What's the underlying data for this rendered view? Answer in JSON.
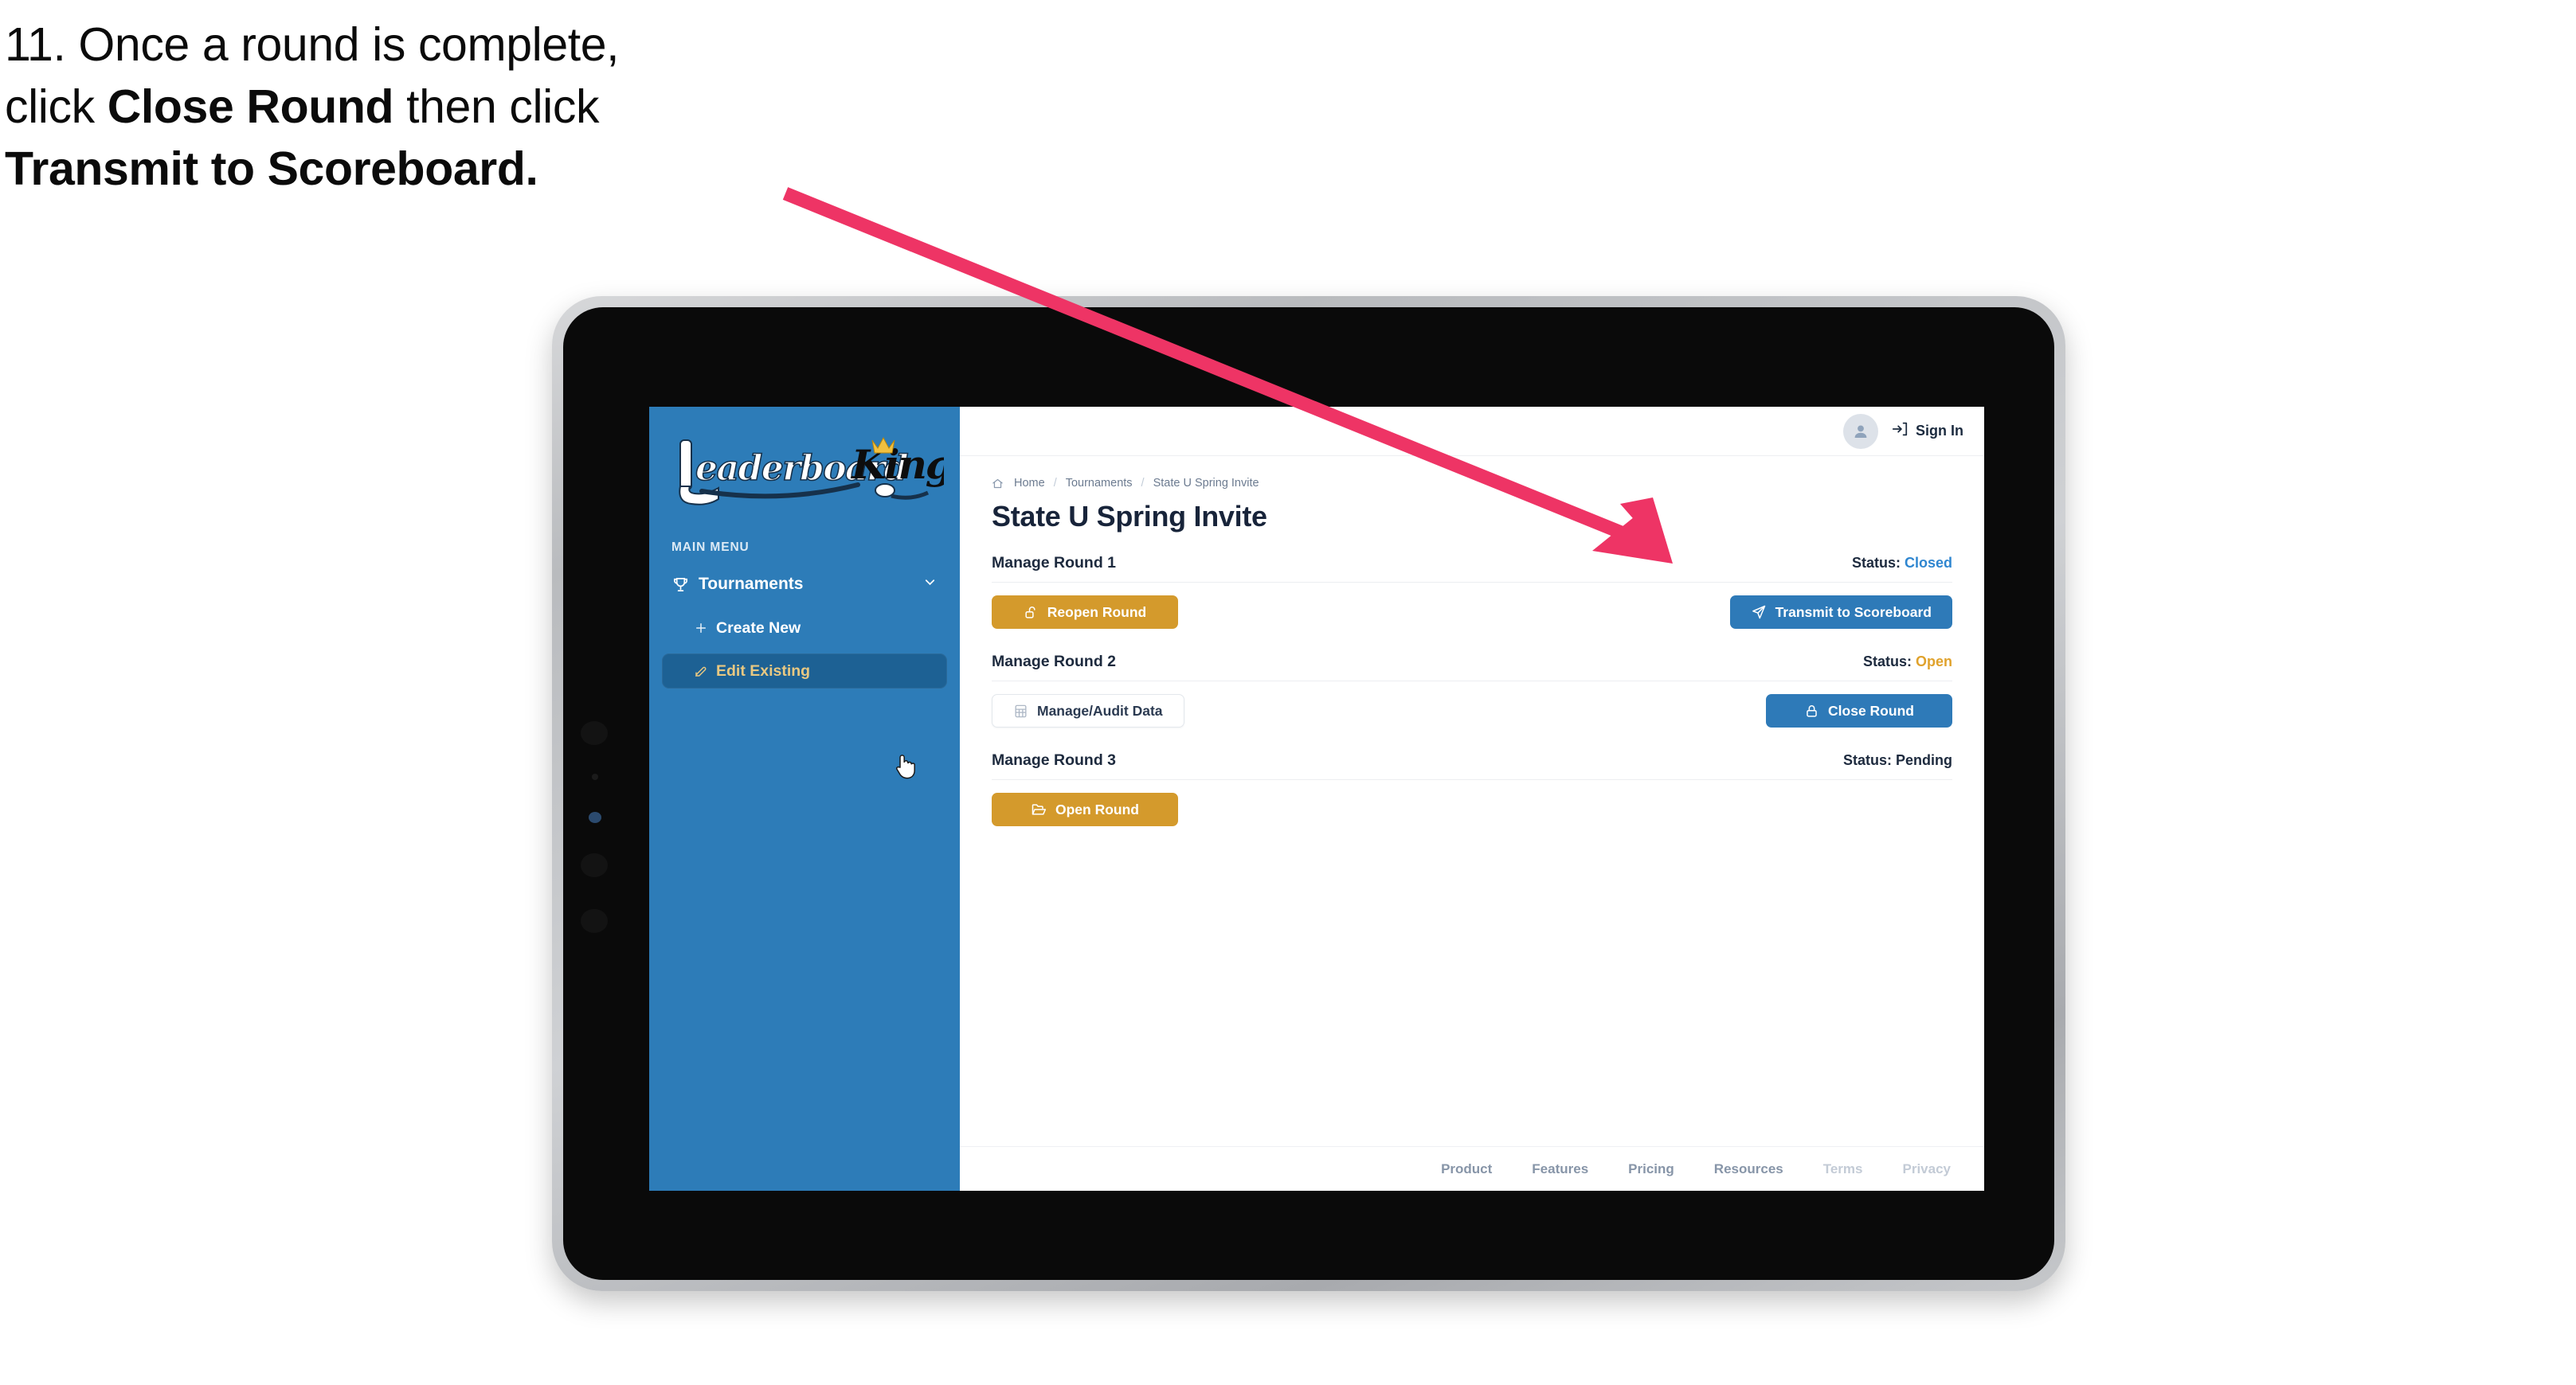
{
  "instruction": {
    "step_number": "11.",
    "line1_prefix": "11. Once a round is complete,",
    "line2_prefix": "click ",
    "line2_bold": "Close Round",
    "line2_suffix": " then click",
    "line3_bold": "Transmit to Scoreboard.",
    "arrow_color": "#ee3465"
  },
  "app": {
    "sidebar": {
      "logo": {
        "word_one": "Leaderboard",
        "word_two": "King",
        "crown_color": "#f0c040"
      },
      "section_label": "MAIN MENU",
      "items": [
        {
          "label": "Tournaments",
          "icon": "trophy-icon",
          "chevron": "chevron-down-icon",
          "active": false
        },
        {
          "label": "Create New",
          "icon": "plus-icon",
          "active": false
        },
        {
          "label": "Edit Existing",
          "icon": "edit-pencil-icon",
          "active": true
        }
      ],
      "background_color": "#2d7cb8",
      "active_background_color": "#1d6194",
      "active_text_color": "#e8c882"
    },
    "topbar": {
      "avatar_icon": "user-avatar-icon",
      "signin_icon": "sign-in-arrow-icon",
      "signin_label": "Sign In"
    },
    "breadcrumb": {
      "home_icon": "home-icon",
      "items": [
        "Home",
        "Tournaments",
        "State U Spring Invite"
      ],
      "separator": "/"
    },
    "page_title": "State U Spring Invite",
    "rounds": [
      {
        "name": "Manage Round 1",
        "status_label": "Status:",
        "status_value": "Closed",
        "status_class": "status-closed",
        "left_button": {
          "label": "Reopen Round",
          "icon": "unlock-icon",
          "style": "btn-gold"
        },
        "right_button": {
          "label": "Transmit to Scoreboard",
          "icon": "send-paper-plane-icon",
          "style": "btn-blue"
        }
      },
      {
        "name": "Manage Round 2",
        "status_label": "Status:",
        "status_value": "Open",
        "status_class": "status-open",
        "left_button": {
          "label": "Manage/Audit Data",
          "icon": "spreadsheet-icon",
          "style": "btn-ghost"
        },
        "right_button": {
          "label": "Close Round",
          "icon": "lock-icon",
          "style": "btn-blue"
        }
      },
      {
        "name": "Manage Round 3",
        "status_label": "Status:",
        "status_value": "Pending",
        "status_class": "status-pending",
        "left_button": {
          "label": "Open Round",
          "icon": "open-folder-icon",
          "style": "btn-gold"
        },
        "right_button": null
      }
    ],
    "footer": {
      "links": [
        {
          "label": "Product",
          "muted": false
        },
        {
          "label": "Features",
          "muted": false
        },
        {
          "label": "Pricing",
          "muted": false
        },
        {
          "label": "Resources",
          "muted": false
        },
        {
          "label": "Terms",
          "muted": true
        },
        {
          "label": "Privacy",
          "muted": true
        }
      ]
    },
    "cursor": {
      "icon": "pointing-hand-cursor"
    }
  },
  "colors": {
    "gold": "#d49a2c",
    "blue": "#2e7ab8",
    "sidebar_blue": "#2d7cb8",
    "status_closed": "#2f86d0",
    "status_open": "#e0a22c",
    "arrow_pink": "#ee3465"
  }
}
